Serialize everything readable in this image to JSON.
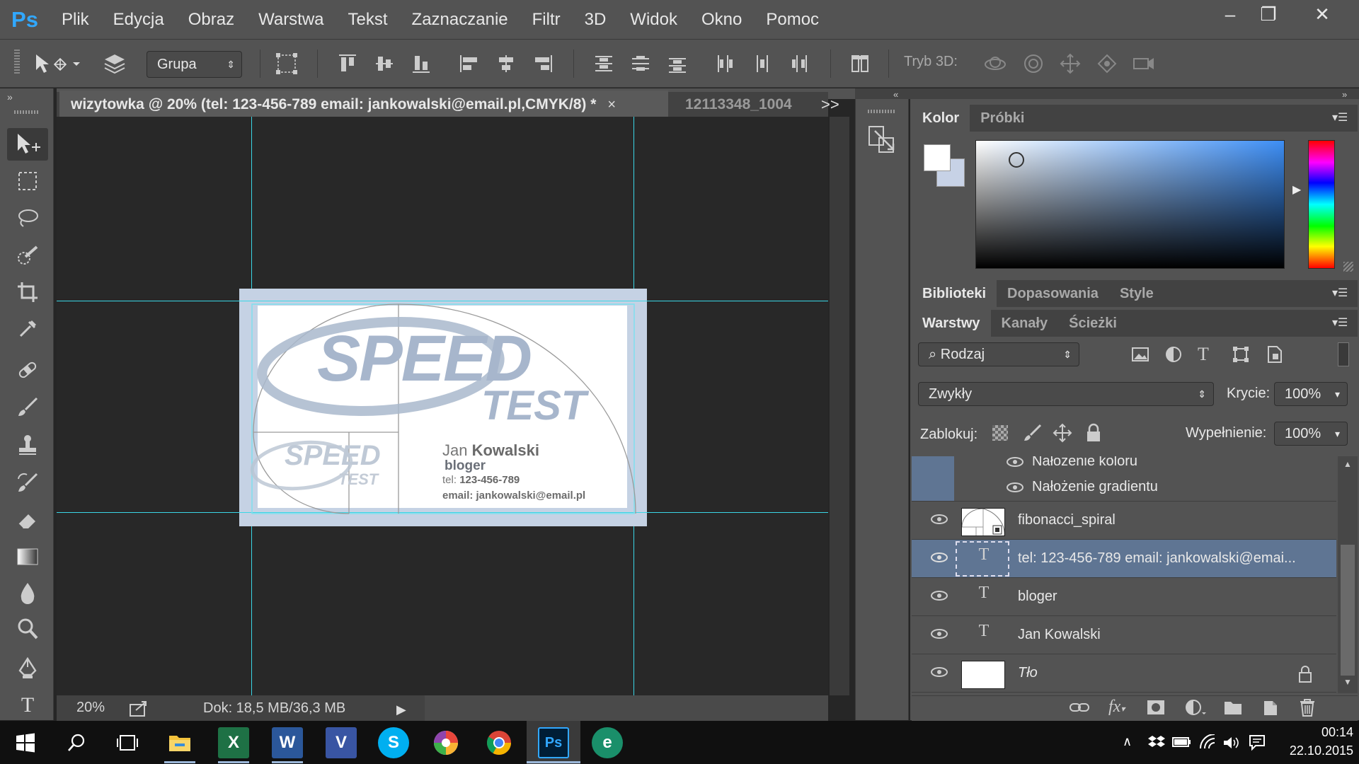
{
  "app": {
    "logo": "Ps"
  },
  "menu": [
    "Plik",
    "Edycja",
    "Obraz",
    "Warstwa",
    "Tekst",
    "Zaznaczanie",
    "Filtr",
    "3D",
    "Widok",
    "Okno",
    "Pomoc"
  ],
  "window_controls": {
    "minimize": "–",
    "restore": "❐",
    "close": "✕"
  },
  "options": {
    "auto_select_value": "Grupa",
    "mode_3d_label": "Tryb 3D:"
  },
  "document": {
    "active_tab": "wizytowka @ 20% (tel: 123-456-789   email: jankowalski@email.pl,CMYK/8) *",
    "tab_close": "×",
    "second_tab": "12113348_1004",
    "tabs_overflow": ">>",
    "zoom": "20%",
    "doc_size": "Dok: 18,5 MB/36,3 MB"
  },
  "card": {
    "logo_big_1": "SPEED",
    "logo_big_2": "TEST",
    "logo_small_1": "SPEED",
    "logo_small_2": "TEST",
    "first_name": "Jan ",
    "last_name": "Kowalski",
    "role": "bloger",
    "tel_label": "tel: ",
    "tel_value": "123-456-789",
    "email": "email: jankowalski@email.pl"
  },
  "color_panel": {
    "tabs": [
      "Kolor",
      "Próbki"
    ],
    "fg": "#ffffff",
    "bg": "#c7d2e6"
  },
  "lib_panel": {
    "tabs": [
      "Biblioteki",
      "Dopasowania",
      "Style"
    ]
  },
  "layers_panel": {
    "tabs": [
      "Warstwy",
      "Kanały",
      "Ścieżki"
    ],
    "filter": "Rodzaj",
    "blend_mode": "Zwykły",
    "opacity_label": "Krycie:",
    "opacity": "100%",
    "lock_label": "Zablokuj:",
    "fill_label": "Wypełnienie:",
    "fill": "100%",
    "effects": [
      "Nałożenie koloru",
      "Nałożenie gradientu"
    ],
    "layers": [
      {
        "name": "fibonacci_spiral",
        "kind": "smart-object"
      },
      {
        "name": "tel: 123-456-789    email: jankowalski@emai...",
        "kind": "text",
        "selected": true
      },
      {
        "name": "bloger",
        "kind": "text"
      },
      {
        "name": "Jan Kowalski",
        "kind": "text"
      },
      {
        "name": "Tło",
        "kind": "background",
        "locked": true
      }
    ]
  },
  "taskbar": {
    "apps": [
      "windows-start",
      "search",
      "task-view",
      "file-explorer",
      "excel",
      "word",
      "visio",
      "skype",
      "picasa",
      "chrome",
      "photoshop",
      "edge"
    ],
    "time": "00:14",
    "date": "22.10.2015"
  }
}
